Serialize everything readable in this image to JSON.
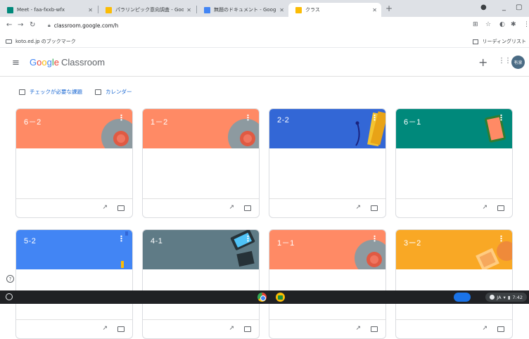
{
  "browser": {
    "tabs": [
      {
        "title": "Meet - faa-fxxb-wfx",
        "favicon_color": "#00897b"
      },
      {
        "title": "パラリンピック意向調査 - Goo",
        "favicon_color": "#fbbc05"
      },
      {
        "title": "無題のドキュメント - Google",
        "favicon_color": "#4285f4"
      },
      {
        "title": "クラス",
        "favicon_color": "#fbbc05"
      }
    ],
    "url": "classroom.google.com/h",
    "bookmarks": {
      "left_item": "koto.ed.jp のブックマーク",
      "reading_list": "リーディングリスト"
    }
  },
  "app": {
    "logo_google": [
      "G",
      "o",
      "o",
      "g",
      "l",
      "e"
    ],
    "logo_product": "Classroom",
    "avatar_text": "有泉"
  },
  "subnav": {
    "todo": "チェックが必要な課題",
    "calendar": "カレンダー"
  },
  "courses": [
    {
      "name": "6－2",
      "color": "#ff8a65",
      "art": "orange"
    },
    {
      "name": "1－2",
      "color": "#ff8a65",
      "art": "orange"
    },
    {
      "name": "2-2",
      "color": "#3367d6",
      "art": "blue"
    },
    {
      "name": "6－1",
      "color": "#00897b",
      "art": "teal"
    },
    {
      "name": "5-2",
      "color": "#4285f4",
      "art": "blue2"
    },
    {
      "name": "4-1",
      "color": "#5f7b86",
      "art": "slate"
    },
    {
      "name": "1－1",
      "color": "#ff8a65",
      "art": "orange"
    },
    {
      "name": "3ー2",
      "color": "#f9a825",
      "art": "yellow"
    }
  ],
  "tray": {
    "lang": "JA",
    "time": "7:42"
  }
}
